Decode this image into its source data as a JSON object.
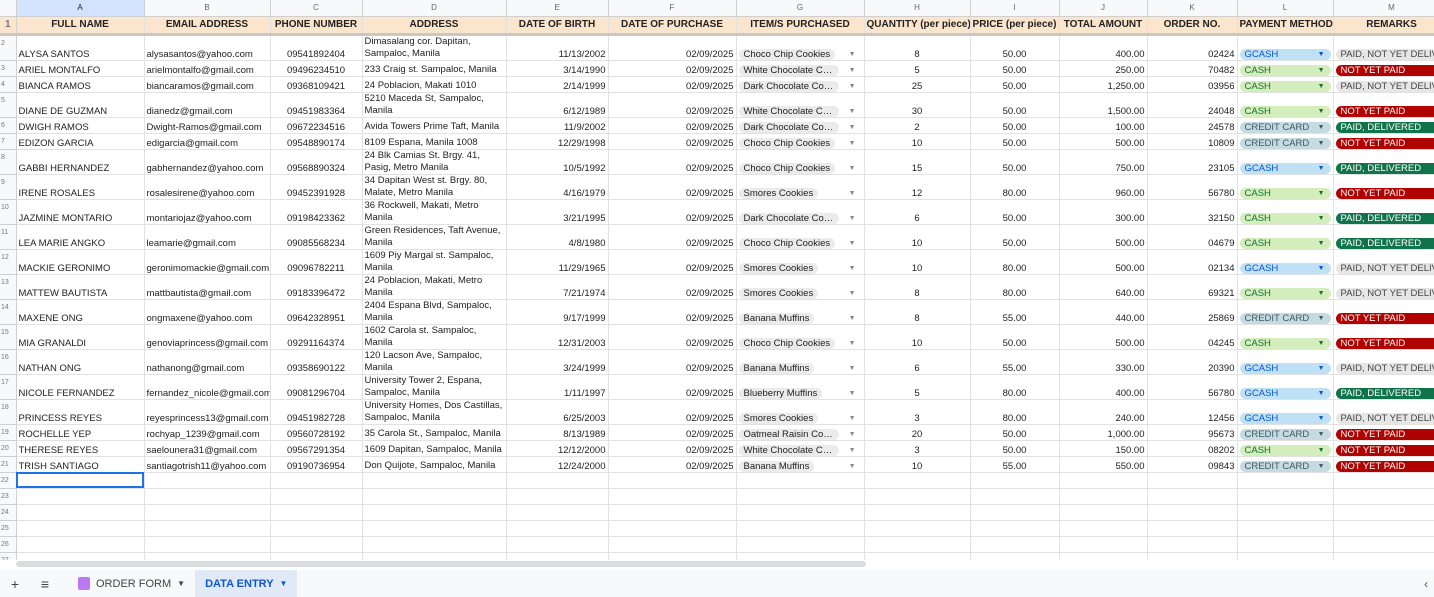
{
  "columns": [
    "A",
    "B",
    "C",
    "D",
    "E",
    "F",
    "G",
    "H",
    "I",
    "J",
    "K",
    "L",
    "M"
  ],
  "headers": [
    "FULL NAME",
    "EMAIL ADDRESS",
    "PHONE NUMBER",
    "ADDRESS",
    "DATE OF BIRTH",
    "DATE OF PURCHASE",
    "ITEM/S PURCHASED",
    "QUANTITY (per piece)",
    "PRICE (per piece)",
    "TOTAL AMOUNT",
    "ORDER NO.",
    "PAYMENT METHOD",
    "REMARKS"
  ],
  "rows": [
    [
      "ALYSA SANTOS",
      "alysasantos@yahoo.com",
      "09541892404",
      "Dimasalang cor. Dapitan, Sampaloc, Manila",
      "11/13/2002",
      "02/09/2025",
      "Choco Chip Cookies",
      "8",
      "50.00",
      "400.00",
      "02424",
      "GCASH",
      "PAID, NOT YET DELIVERED"
    ],
    [
      "ARIEL MONTALFO",
      "arielmontalfo@gmail.com",
      "09496234510",
      "233 Craig st. Sampaloc, Manila",
      "3/14/1990",
      "02/09/2025",
      "White Chocolate Cookies",
      "5",
      "50.00",
      "250.00",
      "70482",
      "CASH",
      "NOT YET PAID"
    ],
    [
      "BIANCA RAMOS",
      "biancaramos@gmail.com",
      "09368109421",
      "24 Poblacion, Makati 1010",
      "2/14/1999",
      "02/09/2025",
      "Dark Chocolate Cookies",
      "25",
      "50.00",
      "1,250.00",
      "03956",
      "CASH",
      "PAID, NOT YET DELIVERED"
    ],
    [
      "DIANE DE GUZMAN",
      "dianedz@gmail.com",
      "09451983364",
      "5210 Maceda St, Sampaloc, Manila",
      "6/12/1989",
      "02/09/2025",
      "White Chocolate Cookies",
      "30",
      "50.00",
      "1,500.00",
      "24048",
      "CASH",
      "NOT YET PAID"
    ],
    [
      "DWIGH RAMOS",
      "Dwight-Ramos@gmail.com",
      "09672234516",
      "Avida Towers Prime Taft, Manila",
      "11/9/2002",
      "02/09/2025",
      "Dark Chocolate Cookies",
      "2",
      "50.00",
      "100.00",
      "24578",
      "CREDIT CARD",
      "PAID, DELIVERED"
    ],
    [
      "EDIZON GARCIA",
      "edigarcia@gmail.com",
      "09548890174",
      "8109 Espana, Manila 1008",
      "12/29/1998",
      "02/09/2025",
      "Choco Chip Cookies",
      "10",
      "50.00",
      "500.00",
      "10809",
      "CREDIT CARD",
      "NOT YET PAID"
    ],
    [
      "GABBI HERNANDEZ",
      "gabhernandez@yahoo.com",
      "09568890324",
      "24 Blk Camias St. Brgy. 41, Pasig, Metro Manila",
      "10/5/1992",
      "02/09/2025",
      "Choco Chip Cookies",
      "15",
      "50.00",
      "750.00",
      "23105",
      "GCASH",
      "PAID, DELIVERED"
    ],
    [
      "IRENE ROSALES",
      "rosalesirene@yahoo.com",
      "09452391928",
      "34 Dapitan West st. Brgy. 80, Malate, Metro Manila",
      "4/16/1979",
      "02/09/2025",
      "Smores Cookies",
      "12",
      "80.00",
      "960.00",
      "56780",
      "CASH",
      "NOT YET PAID"
    ],
    [
      "JAZMINE MONTARIO",
      "montariojaz@yahoo.com",
      "09198423362",
      "36 Rockwell, Makati, Metro Manila",
      "3/21/1995",
      "02/09/2025",
      "Dark Chocolate Cookies",
      "6",
      "50.00",
      "300.00",
      "32150",
      "CASH",
      "PAID, DELIVERED"
    ],
    [
      "LEA MARIE ANGKO",
      "leamarie@gmail.com",
      "09085568234",
      "Green Residences, Taft Avenue, Manila",
      "4/8/1980",
      "02/09/2025",
      "Choco Chip Cookies",
      "10",
      "50.00",
      "500.00",
      "04679",
      "CASH",
      "PAID, DELIVERED"
    ],
    [
      "MACKIE GERONIMO",
      "geronimomackie@gmail.com",
      "09096782211",
      "1609 Piy Margal st. Sampaloc, Manila",
      "11/29/1965",
      "02/09/2025",
      "Smores Cookies",
      "10",
      "80.00",
      "500.00",
      "02134",
      "GCASH",
      "PAID, NOT YET DELIVERED"
    ],
    [
      "MATTEW BAUTISTA",
      "mattbautista@gmail.com",
      "09183396472",
      "24 Poblacion, Makati, Metro Manila",
      "7/21/1974",
      "02/09/2025",
      "Smores Cookies",
      "8",
      "80.00",
      "640.00",
      "69321",
      "CASH",
      "PAID, NOT YET DELIVERED"
    ],
    [
      "MAXENE ONG",
      "ongmaxene@yahoo.com",
      "09642328951",
      "2404 Espana Blvd, Sampaloc, Manila",
      "9/17/1999",
      "02/09/2025",
      "Banana Muffins",
      "8",
      "55.00",
      "440.00",
      "25869",
      "CREDIT CARD",
      "NOT YET PAID"
    ],
    [
      "MIA GRANALDI",
      "genoviaprincess@gmail.com",
      "09291164374",
      "1602 Carola st. Sampaloc, Manila",
      "12/31/2003",
      "02/09/2025",
      "Choco Chip Cookies",
      "10",
      "50.00",
      "500.00",
      "04245",
      "CASH",
      "NOT YET PAID"
    ],
    [
      "NATHAN ONG",
      "nathanong@gmail.com",
      "09358690122",
      "120 Lacson Ave, Sampaloc, Manila",
      "3/24/1999",
      "02/09/2025",
      "Banana Muffins",
      "6",
      "55.00",
      "330.00",
      "20390",
      "GCASH",
      "PAID, NOT YET DELIVERED"
    ],
    [
      "NICOLE FERNANDEZ",
      "fernandez_nicole@gmail.com",
      "09081296704",
      "University Tower 2, Espana, Sampaloc, Manila",
      "1/11/1997",
      "02/09/2025",
      "Blueberry Muffins",
      "5",
      "80.00",
      "400.00",
      "56780",
      "GCASH",
      "PAID, DELIVERED"
    ],
    [
      "PRINCESS REYES",
      "reyesprincess13@gmail.com",
      "09451982728",
      "University Homes, Dos Castillas, Sampaloc, Manila",
      "6/25/2003",
      "02/09/2025",
      "Smores Cookies",
      "3",
      "80.00",
      "240.00",
      "12456",
      "GCASH",
      "PAID, NOT YET DELIVERED"
    ],
    [
      "ROCHELLE YEP",
      "rochyap_1239@gmail.com",
      "09560728192",
      "35 Carola St., Sampaloc, Manila",
      "8/13/1989",
      "02/09/2025",
      "Oatmeal Raisin Cookies",
      "20",
      "50.00",
      "1,000.00",
      "95673",
      "CREDIT CARD",
      "NOT YET PAID"
    ],
    [
      "THERESE REYES",
      "saelounera31@gmail.com",
      "09567291354",
      "1609 Dapitan, Sampaloc, Manila",
      "12/12/2000",
      "02/09/2025",
      "White Chocolate Cookies",
      "3",
      "50.00",
      "150.00",
      "08202",
      "CASH",
      "NOT YET PAID"
    ],
    [
      "TRISH SANTIAGO",
      "santiagotrish11@yahoo.com",
      "09190736954",
      "Don Quijote, Sampaloc, Manila",
      "12/24/2000",
      "02/09/2025",
      "Banana Muffins",
      "10",
      "55.00",
      "550.00",
      "09843",
      "CREDIT CARD",
      "NOT YET PAID"
    ]
  ],
  "empty_row_count": 8,
  "tabs": {
    "order_form": "ORDER FORM",
    "data_entry": "DATA ENTRY"
  }
}
